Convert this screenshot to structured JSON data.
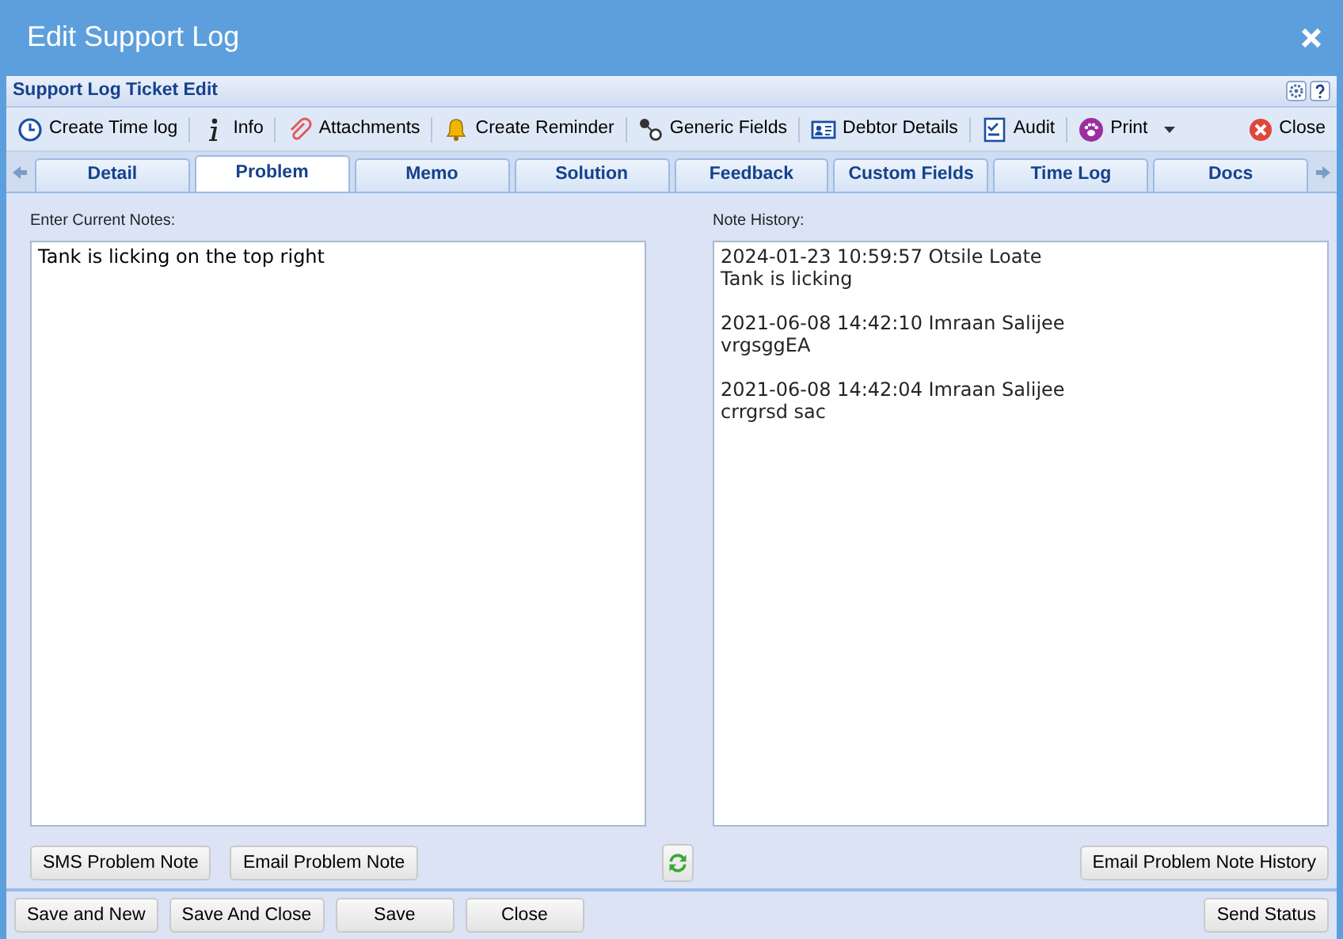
{
  "window": {
    "title": "Edit Support Log"
  },
  "panel": {
    "title": "Support Log Ticket Edit"
  },
  "toolbar": [
    {
      "kind": "clock",
      "label": "Create Time log"
    },
    {
      "kind": "info",
      "label": "Info"
    },
    {
      "kind": "clip",
      "label": "Attachments"
    },
    {
      "kind": "bell",
      "label": "Create Reminder"
    },
    {
      "kind": "nodes",
      "label": "Generic Fields"
    },
    {
      "kind": "card",
      "label": "Debtor Details"
    },
    {
      "kind": "check",
      "label": "Audit"
    },
    {
      "kind": "paw",
      "label": "Print",
      "dropdown": true
    },
    {
      "kind": "close",
      "label": "Close"
    }
  ],
  "tabs": [
    {
      "label": "Detail",
      "selected": false
    },
    {
      "label": "Problem",
      "selected": true
    },
    {
      "label": "Memo",
      "selected": false
    },
    {
      "label": "Solution",
      "selected": false
    },
    {
      "label": "Feedback",
      "selected": false
    },
    {
      "label": "Custom Fields",
      "selected": false
    },
    {
      "label": "Time Log",
      "selected": false
    },
    {
      "label": "Docs",
      "selected": false
    }
  ],
  "current_notes": {
    "label": "Enter Current Notes:",
    "value": "Tank is licking on the top right"
  },
  "note_history": {
    "label": "Note History:",
    "entries": [
      {
        "header": "2024-01-23 10:59:57 Otsile Loate",
        "text": "Tank is licking"
      },
      {
        "header": "2021-06-08 14:42:10 Imraan Salijee",
        "text": "vrgsggEA"
      },
      {
        "header": "2021-06-08 14:42:04 Imraan Salijee",
        "text": "crrgrsd sac"
      }
    ]
  },
  "note_buttons": [
    "SMS Problem Note",
    "Email Problem Note"
  ],
  "history_button": "Email Problem Note History",
  "footer_buttons": [
    "Save and New",
    "Save And Close",
    "Save",
    "Close"
  ],
  "send_button": "Send Status"
}
